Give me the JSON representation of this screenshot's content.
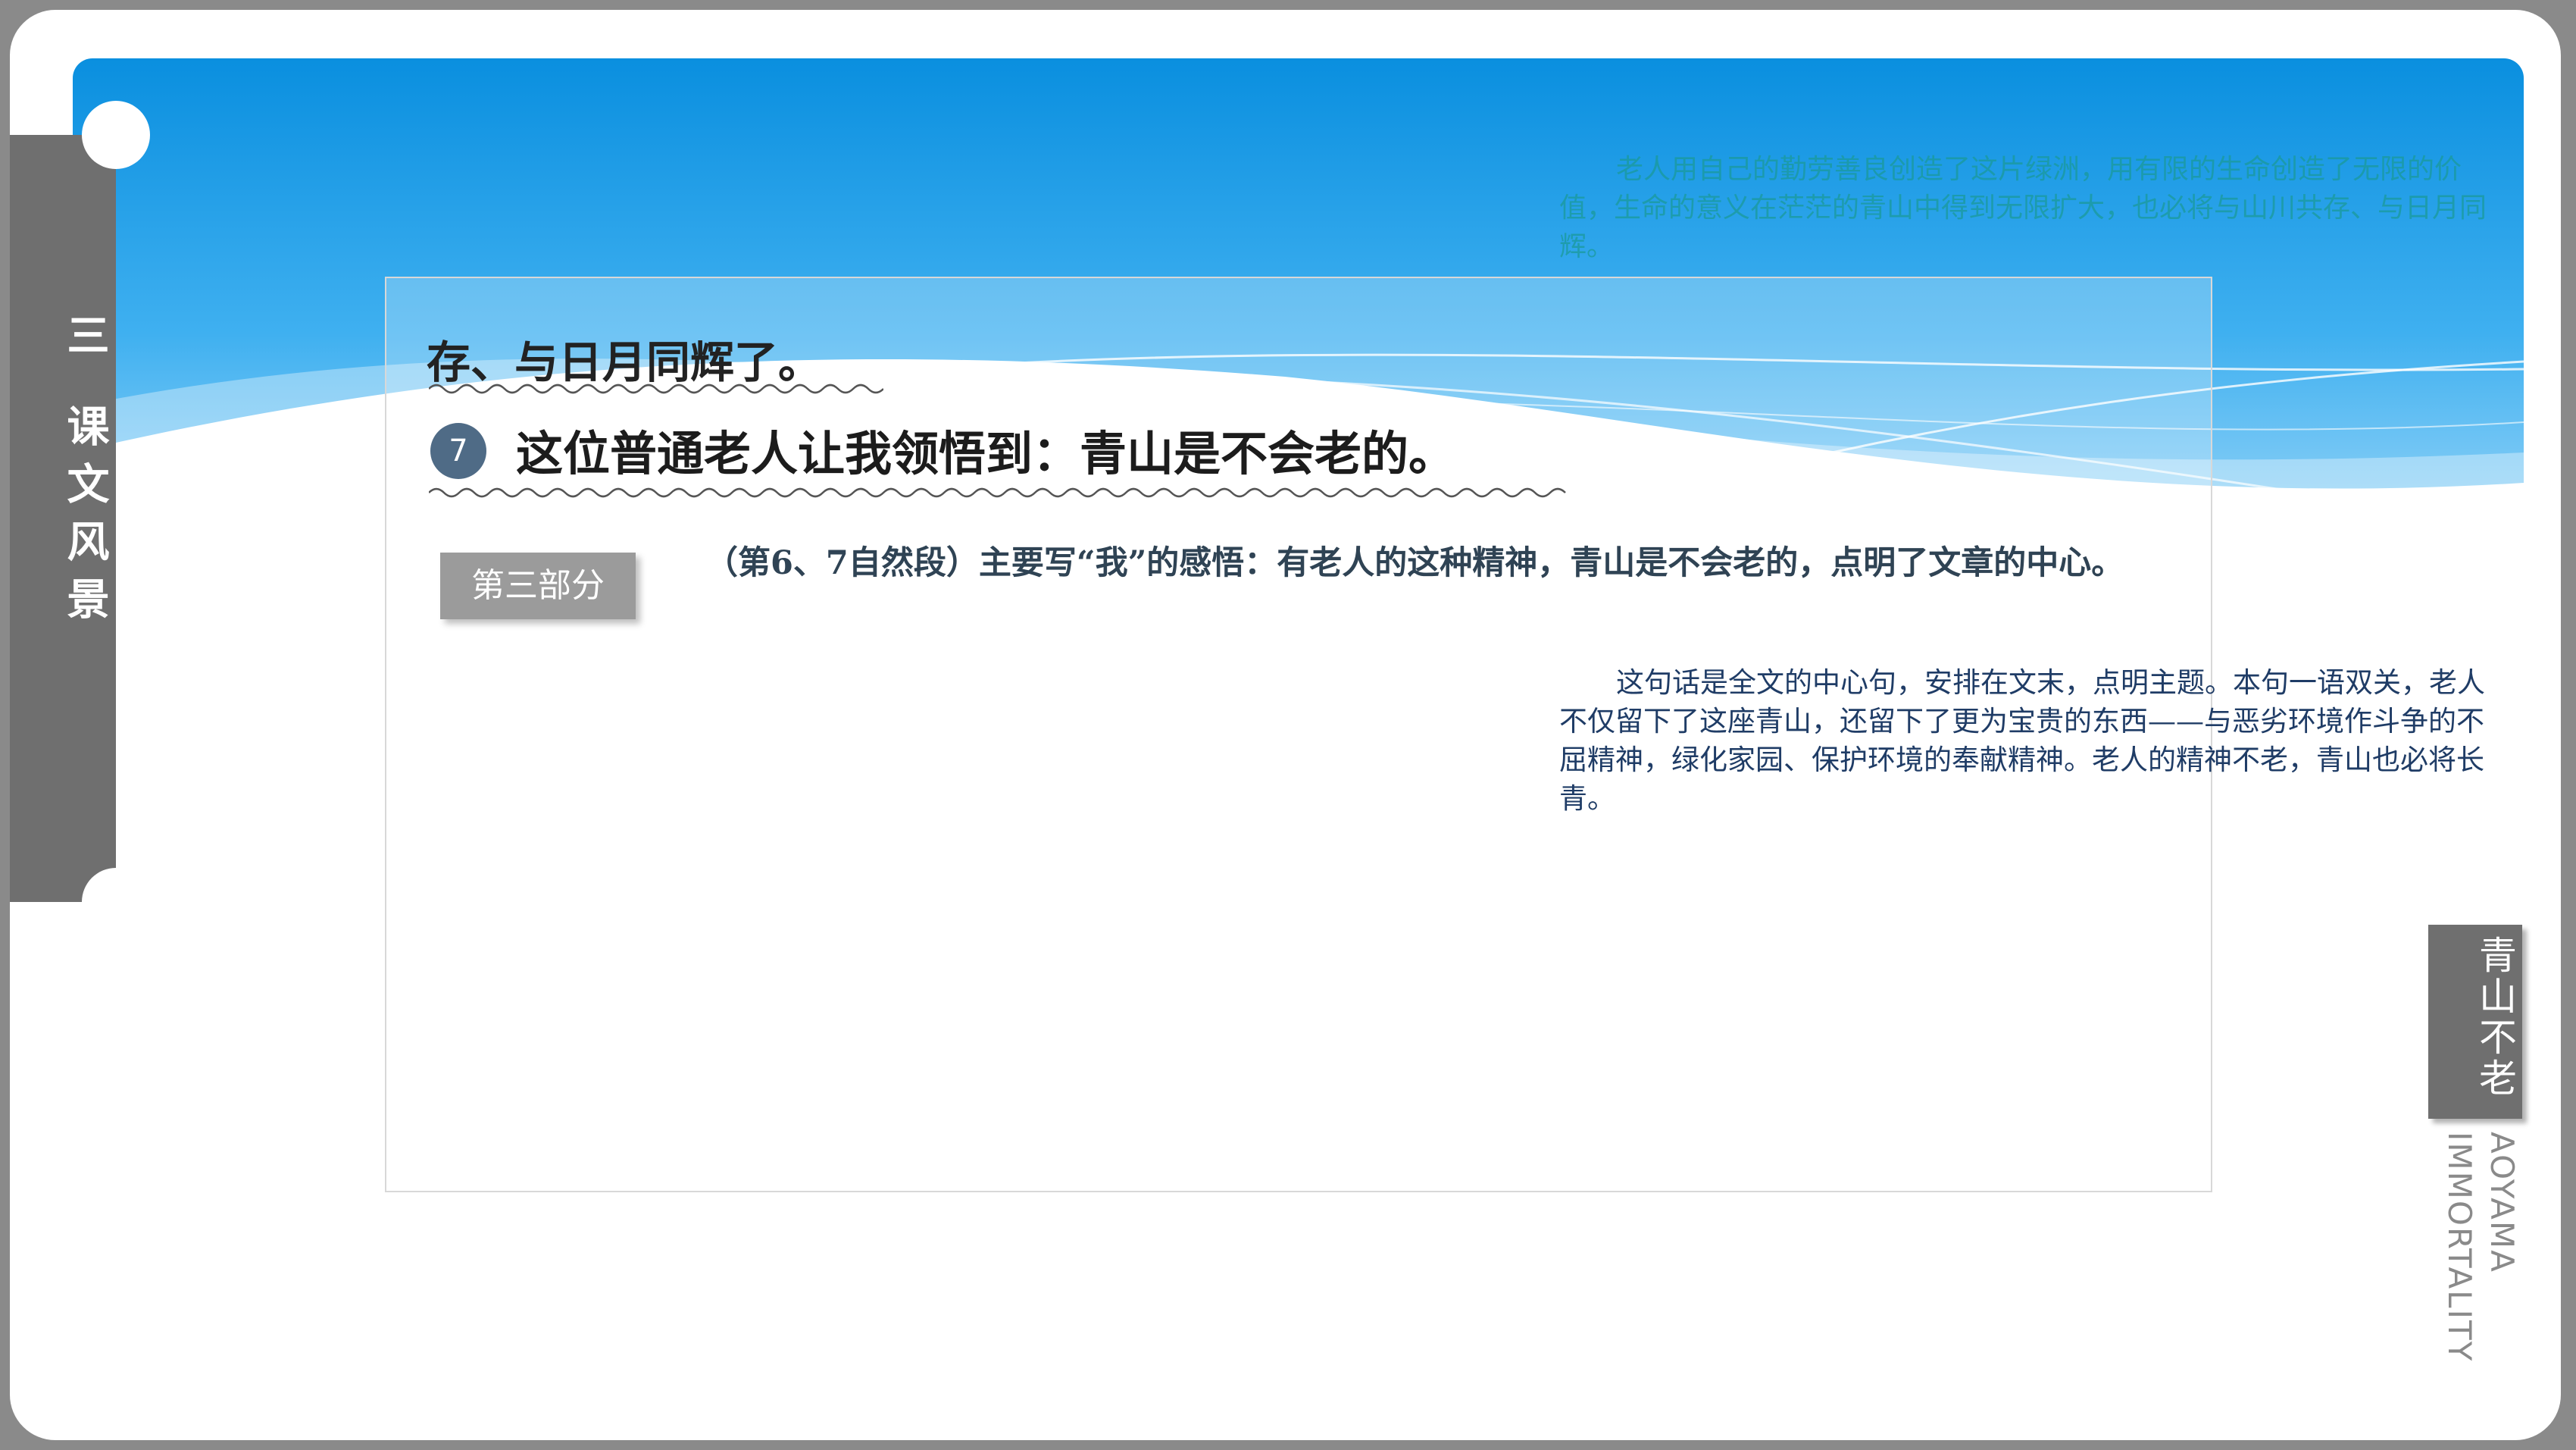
{
  "side_tab": {
    "number": "三",
    "title": "课文风景"
  },
  "lesson": {
    "line1": "存、与日月同辉了。",
    "paragraph_number": "7",
    "line2": "这位普通老人让我领悟到：青山是不会老的。"
  },
  "part_label": "第三部分",
  "summary": "（第6、7自然段）主要写“我”的感悟：有老人的这种精神，青山是不会老的，点明了文章的中心。",
  "note_top": "老人用自己的勤劳善良创造了这片绿洲，用有限的生命创造了无限的价值，生命的意义在茫茫的青山中得到无限扩大，也必将与山川共存、与日月同辉。",
  "note_bottom": "这句话是全文的中心句，安排在文末，点明主题。本句一语双关，老人不仅留下了这座青山，还留下了更为宝贵的东西——与恶劣环境作斗争的不屈精神，绿化家园、保护环境的奉献精神。老人的精神不老，青山也必将长青。",
  "brand": {
    "title": "青山不老",
    "subtitle_1": "AOYAMA",
    "subtitle_2": "IMMORTALITY"
  },
  "colors": {
    "header_top": "#0a8fdf",
    "header_light": "#bfe6fb",
    "side_tab": "#6f6f6f",
    "badge": "#4f6b86",
    "part_button": "#9b9b9b"
  }
}
